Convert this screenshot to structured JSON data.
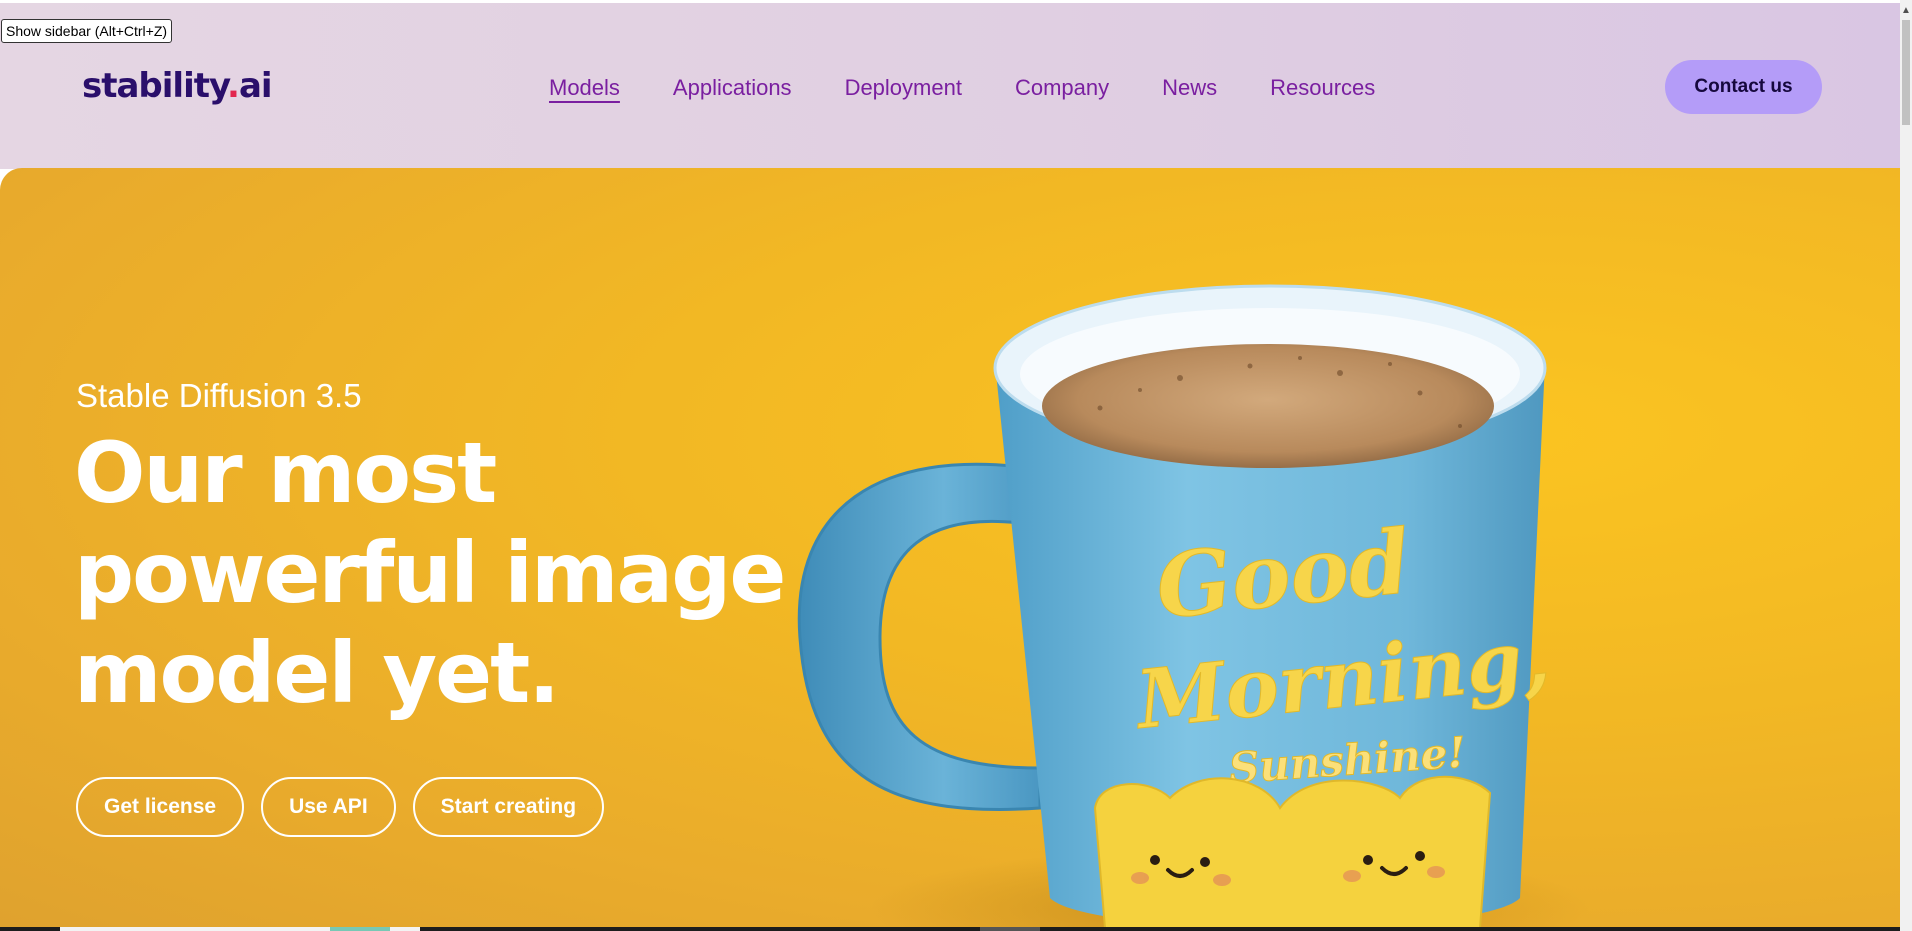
{
  "browser": {
    "sidebar_tooltip": "Show sidebar (Alt+Ctrl+Z)"
  },
  "header": {
    "logo_main": "stability",
    "logo_dot": ".",
    "logo_tld": "ai",
    "nav": [
      {
        "label": "Models",
        "active": true
      },
      {
        "label": "Applications",
        "active": false
      },
      {
        "label": "Deployment",
        "active": false
      },
      {
        "label": "Company",
        "active": false
      },
      {
        "label": "News",
        "active": false
      },
      {
        "label": "Resources",
        "active": false
      }
    ],
    "contact_label": "Contact us"
  },
  "hero": {
    "eyebrow": "Stable Diffusion 3.5",
    "title_lines": [
      "Our most",
      "powerful image",
      "model yet."
    ],
    "buttons": [
      "Get license",
      "Use API",
      "Start creating"
    ],
    "image": {
      "subject": "mug-icon",
      "mug_text_line1": "Good",
      "mug_text_line2": "Morning,",
      "mug_text_line3": "Sunshine!"
    }
  },
  "colors": {
    "brand_dark": "#2a0f6b",
    "brand_red": "#e2274f",
    "nav_purple": "#7a1fa0",
    "contact_bg": "#b49cf8",
    "hero_yellow": "#f2b824",
    "mug_blue": "#6fb7da"
  }
}
